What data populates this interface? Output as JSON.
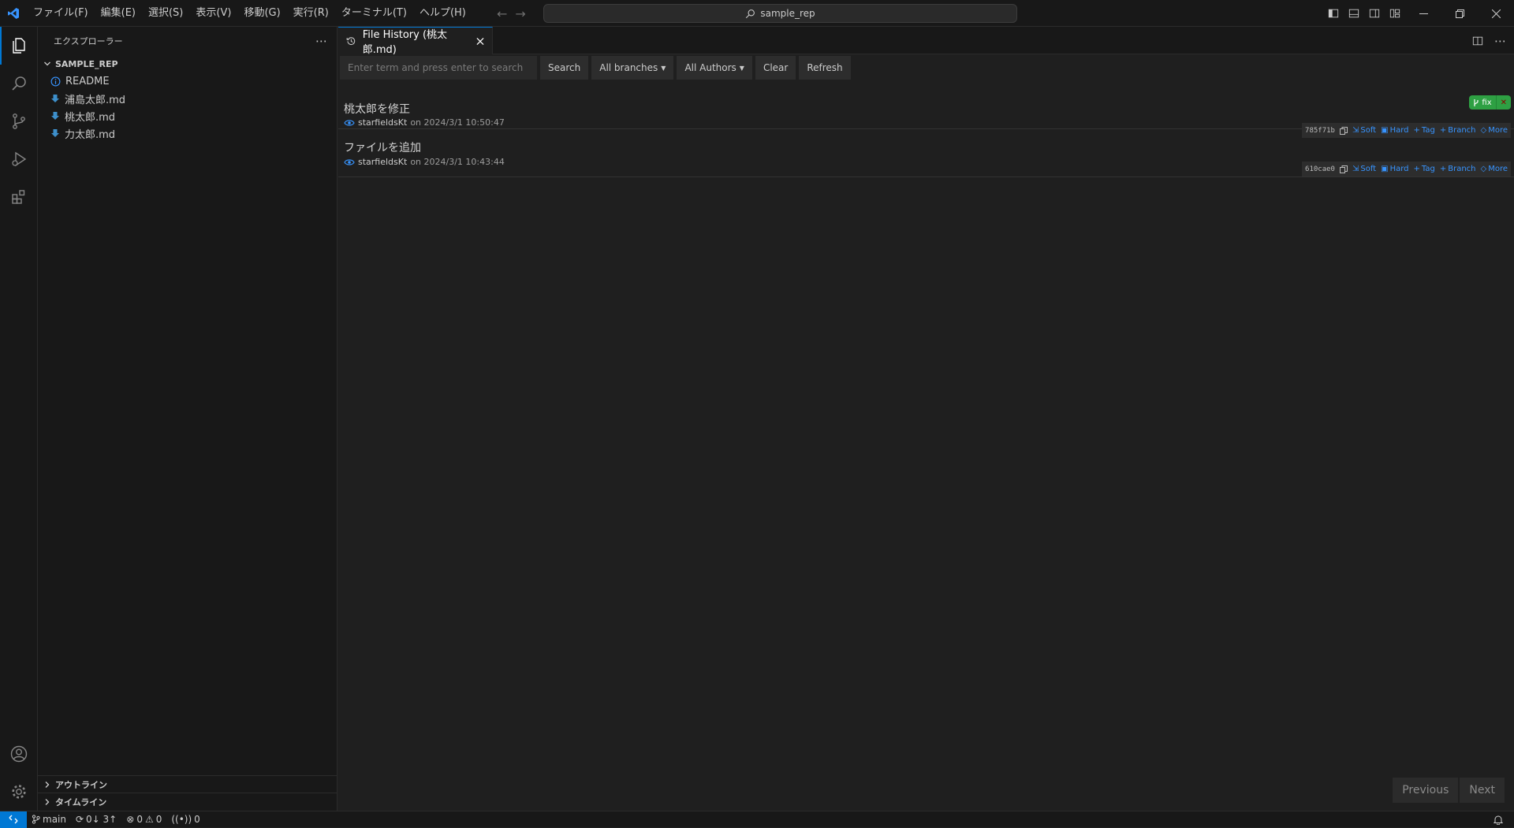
{
  "titlebar": {
    "menu": [
      "ファイル(F)",
      "編集(E)",
      "選択(S)",
      "表示(V)",
      "移動(G)",
      "実行(R)",
      "ターミナル(T)",
      "ヘルプ(H)"
    ],
    "search_text": "sample_rep"
  },
  "sidebar": {
    "header": "エクスプローラー",
    "root": "SAMPLE_REP",
    "files": [
      "README",
      "浦島太郎.md",
      "桃太郎.md",
      "力太郎.md"
    ],
    "outline": "アウトライン",
    "timeline": "タイムライン"
  },
  "editor": {
    "tab_title": "File History (桃太郎.md)",
    "search_placeholder": "Enter term and press enter to search",
    "buttons": {
      "search": "Search",
      "branches": "All branches",
      "authors": "All Authors",
      "clear": "Clear",
      "refresh": "Refresh"
    },
    "commits": [
      {
        "title": "桃太郎を修正",
        "author": "starfieldsKt",
        "date": "on 2024/3/1 10:50:47",
        "hash": "785f71b"
      },
      {
        "title": "ファイルを追加",
        "author": "starfieldsKt",
        "date": "on 2024/3/1 10:43:44",
        "hash": "610cae0"
      }
    ],
    "actions": {
      "soft": "Soft",
      "hard": "Hard",
      "tag": "Tag",
      "branch": "Branch",
      "more": "More"
    },
    "branch_badge": "fix",
    "pager": {
      "previous": "Previous",
      "next": "Next"
    }
  },
  "statusbar": {
    "branch": "main",
    "sync": "0↓ 3↑",
    "errors": "0",
    "warnings": "0",
    "ports": "0"
  },
  "colors": {
    "accent": "#0078d4",
    "link": "#3794ff",
    "badge": "#2ea043"
  }
}
